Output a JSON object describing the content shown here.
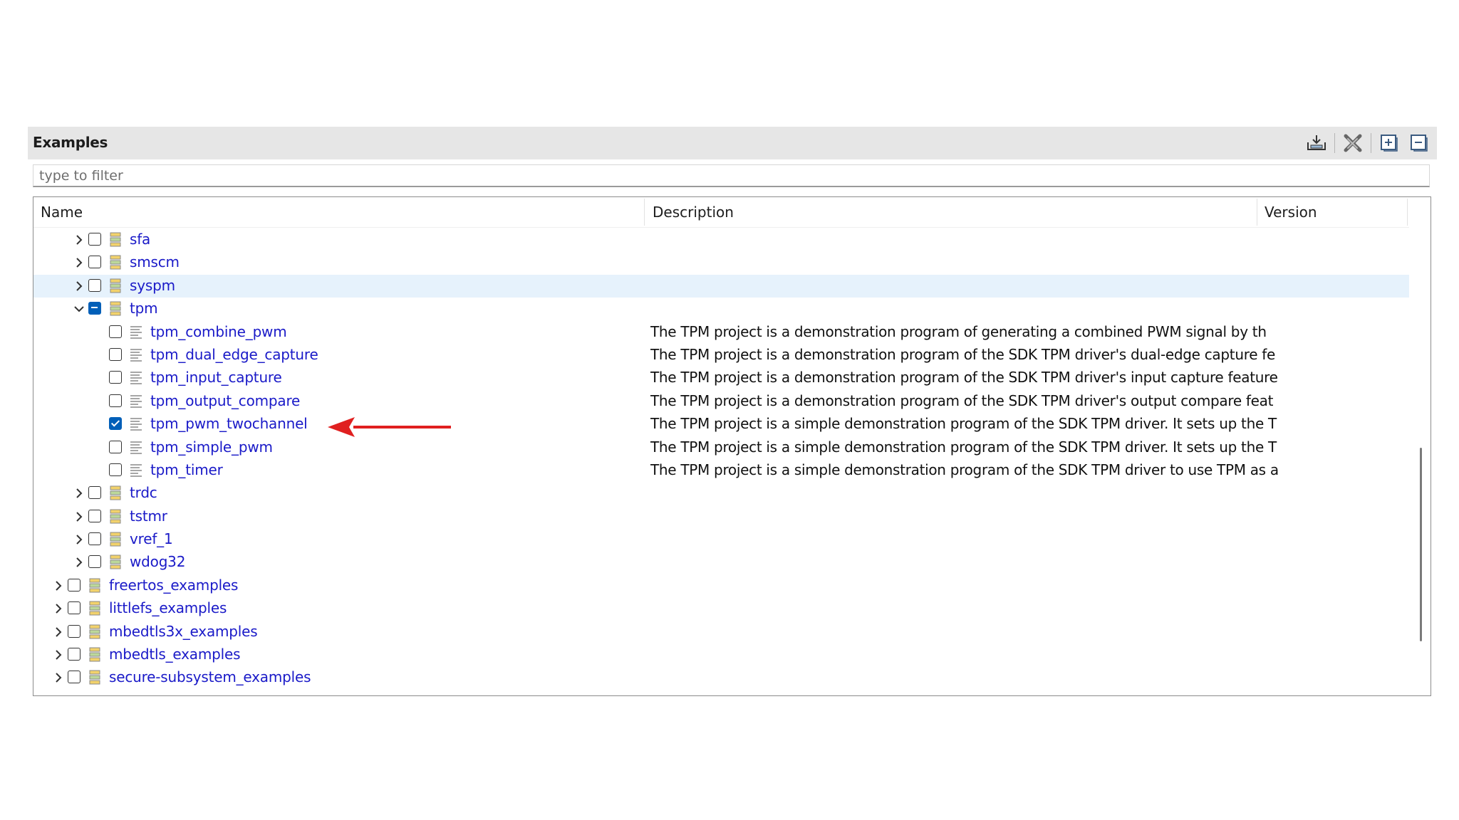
{
  "panel": {
    "title": "Examples",
    "toolbar": [
      "import-icon",
      "delete-all-icon",
      "expand-all-icon",
      "collapse-all-icon"
    ]
  },
  "filter": {
    "placeholder": "type to filter",
    "value": ""
  },
  "columns": {
    "name": "Name",
    "description": "Description",
    "version": "Version"
  },
  "rows": [
    {
      "name": "sfa",
      "level": 2,
      "kind": "folder",
      "twisty": "collapsed",
      "check": "unchecked",
      "desc": "",
      "highlight": false
    },
    {
      "name": "smscm",
      "level": 2,
      "kind": "folder",
      "twisty": "collapsed",
      "check": "unchecked",
      "desc": "",
      "highlight": false
    },
    {
      "name": "syspm",
      "level": 2,
      "kind": "folder",
      "twisty": "collapsed",
      "check": "unchecked",
      "desc": "",
      "highlight": true
    },
    {
      "name": "tpm",
      "level": 2,
      "kind": "folder",
      "twisty": "expanded",
      "check": "partial",
      "desc": "",
      "highlight": false
    },
    {
      "name": "tpm_combine_pwm",
      "level": 3,
      "kind": "project",
      "twisty": "none",
      "check": "unchecked",
      "desc": "The TPM project is a demonstration program of generating a combined PWM signal by th",
      "highlight": false
    },
    {
      "name": "tpm_dual_edge_capture",
      "level": 3,
      "kind": "project",
      "twisty": "none",
      "check": "unchecked",
      "desc": "The TPM project is a demonstration program of the SDK TPM driver's dual-edge capture fe",
      "highlight": false
    },
    {
      "name": "tpm_input_capture",
      "level": 3,
      "kind": "project",
      "twisty": "none",
      "check": "unchecked",
      "desc": "The TPM project is a demonstration program of the SDK TPM driver's input capture feature",
      "highlight": false
    },
    {
      "name": "tpm_output_compare",
      "level": 3,
      "kind": "project",
      "twisty": "none",
      "check": "unchecked",
      "desc": "The TPM project is a demonstration program of the SDK TPM driver's output compare feat",
      "highlight": false
    },
    {
      "name": "tpm_pwm_twochannel",
      "level": 3,
      "kind": "project",
      "twisty": "none",
      "check": "checked",
      "desc": "The TPM project is a simple demonstration program of the SDK TPM driver. It sets up the T",
      "highlight": false
    },
    {
      "name": "tpm_simple_pwm",
      "level": 3,
      "kind": "project",
      "twisty": "none",
      "check": "unchecked",
      "desc": "The TPM project is a simple demonstration program of the SDK TPM driver. It sets up the T",
      "highlight": false
    },
    {
      "name": "tpm_timer",
      "level": 3,
      "kind": "project",
      "twisty": "none",
      "check": "unchecked",
      "desc": "The TPM project is a simple demonstration program of the SDK TPM driver to use TPM as a",
      "highlight": false
    },
    {
      "name": "trdc",
      "level": 2,
      "kind": "folder",
      "twisty": "collapsed",
      "check": "unchecked",
      "desc": "",
      "highlight": false
    },
    {
      "name": "tstmr",
      "level": 2,
      "kind": "folder",
      "twisty": "collapsed",
      "check": "unchecked",
      "desc": "",
      "highlight": false
    },
    {
      "name": "vref_1",
      "level": 2,
      "kind": "folder",
      "twisty": "collapsed",
      "check": "unchecked",
      "desc": "",
      "highlight": false
    },
    {
      "name": "wdog32",
      "level": 2,
      "kind": "folder",
      "twisty": "collapsed",
      "check": "unchecked",
      "desc": "",
      "highlight": false
    },
    {
      "name": "freertos_examples",
      "level": 1,
      "kind": "folder",
      "twisty": "collapsed",
      "check": "unchecked",
      "desc": "",
      "highlight": false
    },
    {
      "name": "littlefs_examples",
      "level": 1,
      "kind": "folder",
      "twisty": "collapsed",
      "check": "unchecked",
      "desc": "",
      "highlight": false
    },
    {
      "name": "mbedtls3x_examples",
      "level": 1,
      "kind": "folder",
      "twisty": "collapsed",
      "check": "unchecked",
      "desc": "",
      "highlight": false
    },
    {
      "name": "mbedtls_examples",
      "level": 1,
      "kind": "folder",
      "twisty": "collapsed",
      "check": "unchecked",
      "desc": "",
      "highlight": false
    },
    {
      "name": "secure-subsystem_examples",
      "level": 1,
      "kind": "folder",
      "twisty": "collapsed",
      "check": "unchecked",
      "desc": "",
      "highlight": false
    }
  ],
  "colors": {
    "link": "#1a1ac8",
    "accent": "#005fb8",
    "highlight": "#e6f2fc",
    "arrow": "#e02020"
  }
}
